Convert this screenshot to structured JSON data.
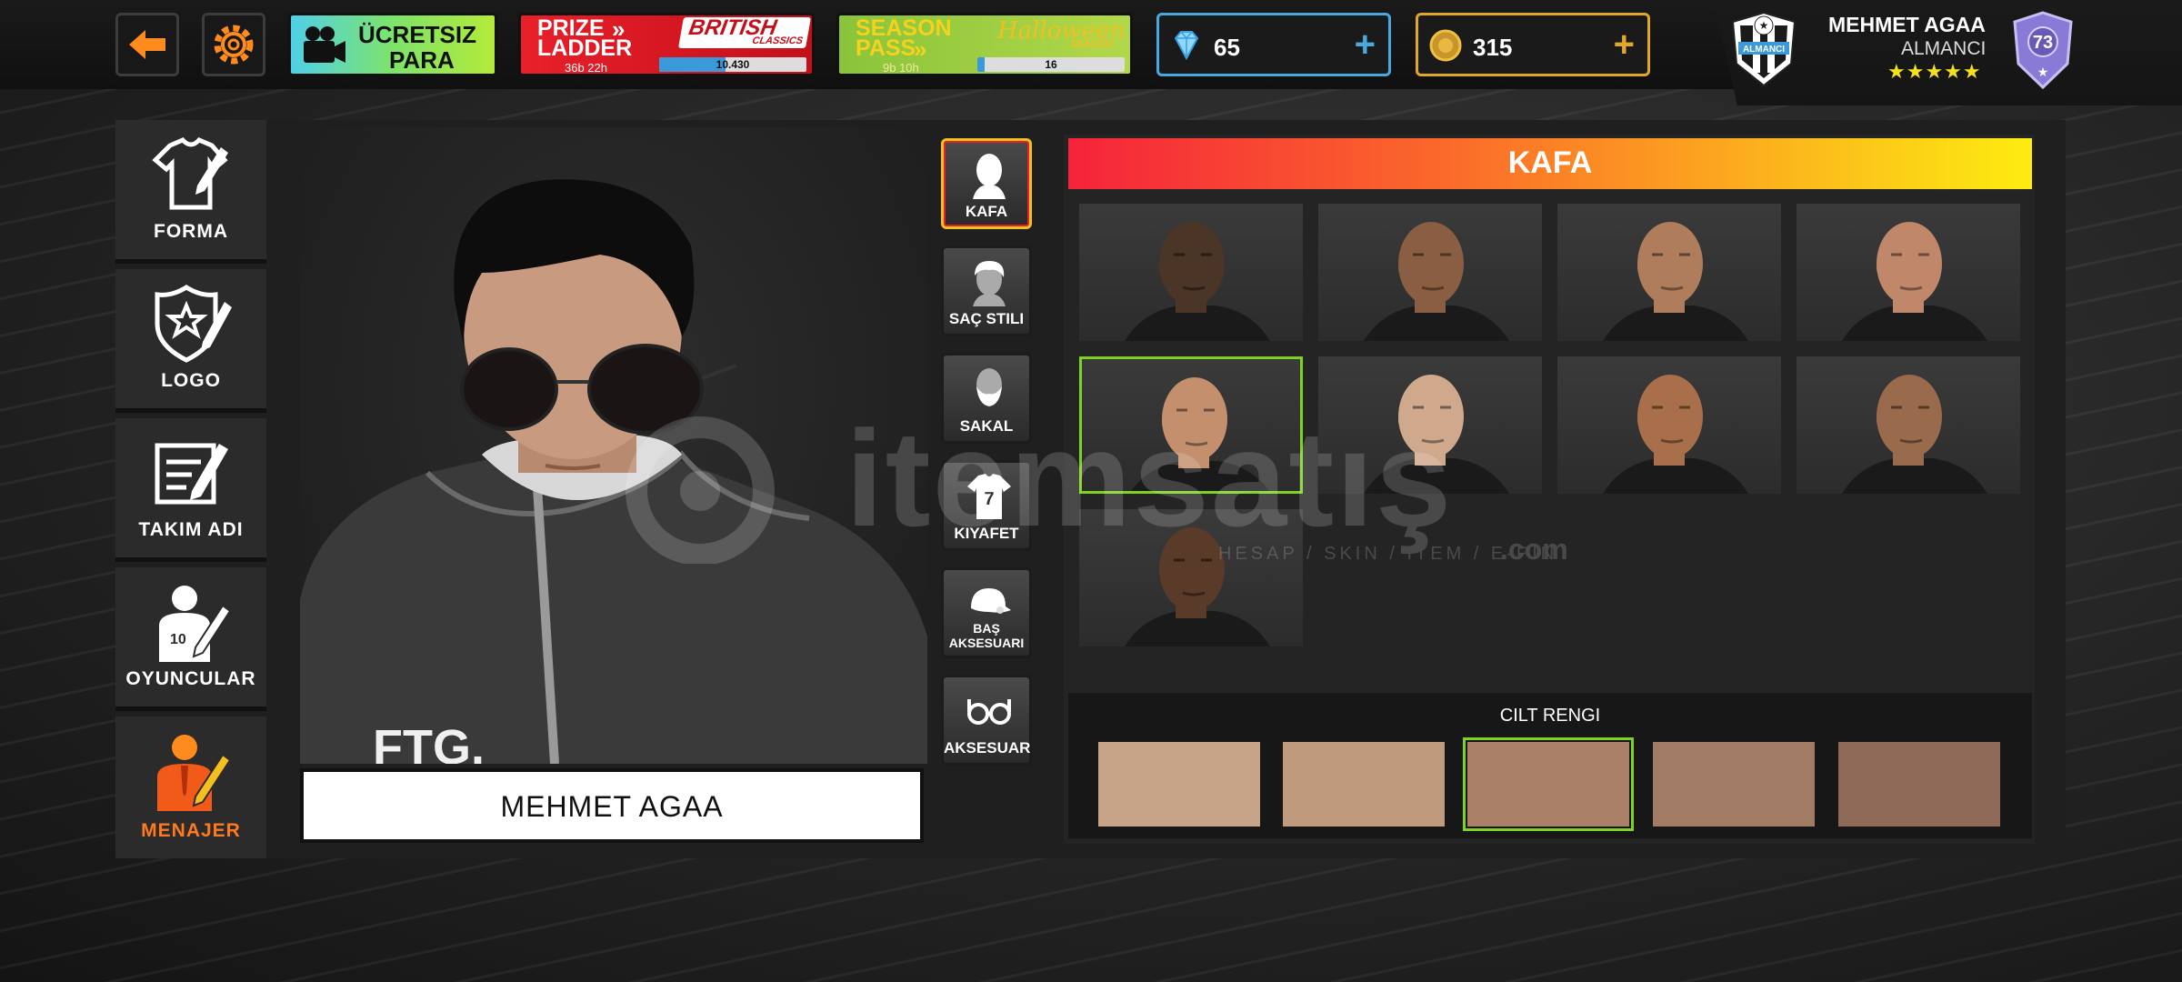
{
  "topbar": {
    "free_money": {
      "line1": "ÜCRETSIZ",
      "line2": "PARA"
    },
    "prize_ladder": {
      "title1": "PRIZE",
      "title2": "LADDER",
      "timer": "36b 22h",
      "brand": "BRITISH",
      "brand_sub": "CLASSICS",
      "progress_value": "10.430",
      "progress_fraction": 0.45
    },
    "season_pass": {
      "title1": "SEASON",
      "title2": "PASS",
      "timer": "9b 10h",
      "brand": "Halloween",
      "brand_sub": "SEASON",
      "progress_value": "16",
      "progress_fraction": 0.05
    },
    "diamonds": "65",
    "coins": "315"
  },
  "profile": {
    "name": "MEHMET AGAA",
    "team": "ALMANCI",
    "badge_text": "ALMANCI",
    "stars": "★★★★★",
    "level": "73"
  },
  "nav": [
    {
      "label": "FORMA",
      "icon": "jersey-edit-icon"
    },
    {
      "label": "LOGO",
      "icon": "shield-edit-icon"
    },
    {
      "label": "TAKIM ADI",
      "icon": "team-name-edit-icon"
    },
    {
      "label": "OYUNCULAR",
      "icon": "player-edit-icon"
    },
    {
      "label": "MENAJER",
      "icon": "manager-edit-icon"
    }
  ],
  "manager_name": "MEHMET AGAA",
  "jacket_text": "FTG.",
  "categories": [
    {
      "label": "KAFA",
      "icon": "head-icon"
    },
    {
      "label": "SAÇ STILI",
      "icon": "hair-icon"
    },
    {
      "label": "SAKAL",
      "icon": "beard-icon"
    },
    {
      "label": "KIYAFET",
      "icon": "shirt-icon",
      "number": "7"
    },
    {
      "label": "BAŞ AKSESUARI",
      "icon": "cap-icon"
    },
    {
      "label": "AKSESUAR",
      "icon": "glasses-icon"
    }
  ],
  "panel_title": "KAFA",
  "skin_title": "CILT RENGI",
  "heads": [
    "#4a3526",
    "#8a5e42",
    "#b07d5c",
    "#c0876a",
    "#c48f6c",
    "#d0a88c",
    "#a86f4a",
    "#9a6a4c",
    "#5a3a28"
  ],
  "selected_head": 4,
  "skin_colors": [
    "#c7a487",
    "#c09a7d",
    "#aa8068",
    "#a27b65",
    "#8f6a58"
  ],
  "selected_skin": 2,
  "watermark": {
    "main": "itemsatış",
    "sub": "HESAP / SKIN / ITEM / E-PIN",
    "tld": ".com"
  },
  "colors": {
    "accent_orange": "#ff8a1e",
    "selected_green": "#7ed321",
    "diamond_border": "#4aa8e0",
    "coin_border": "#e0a82a"
  }
}
